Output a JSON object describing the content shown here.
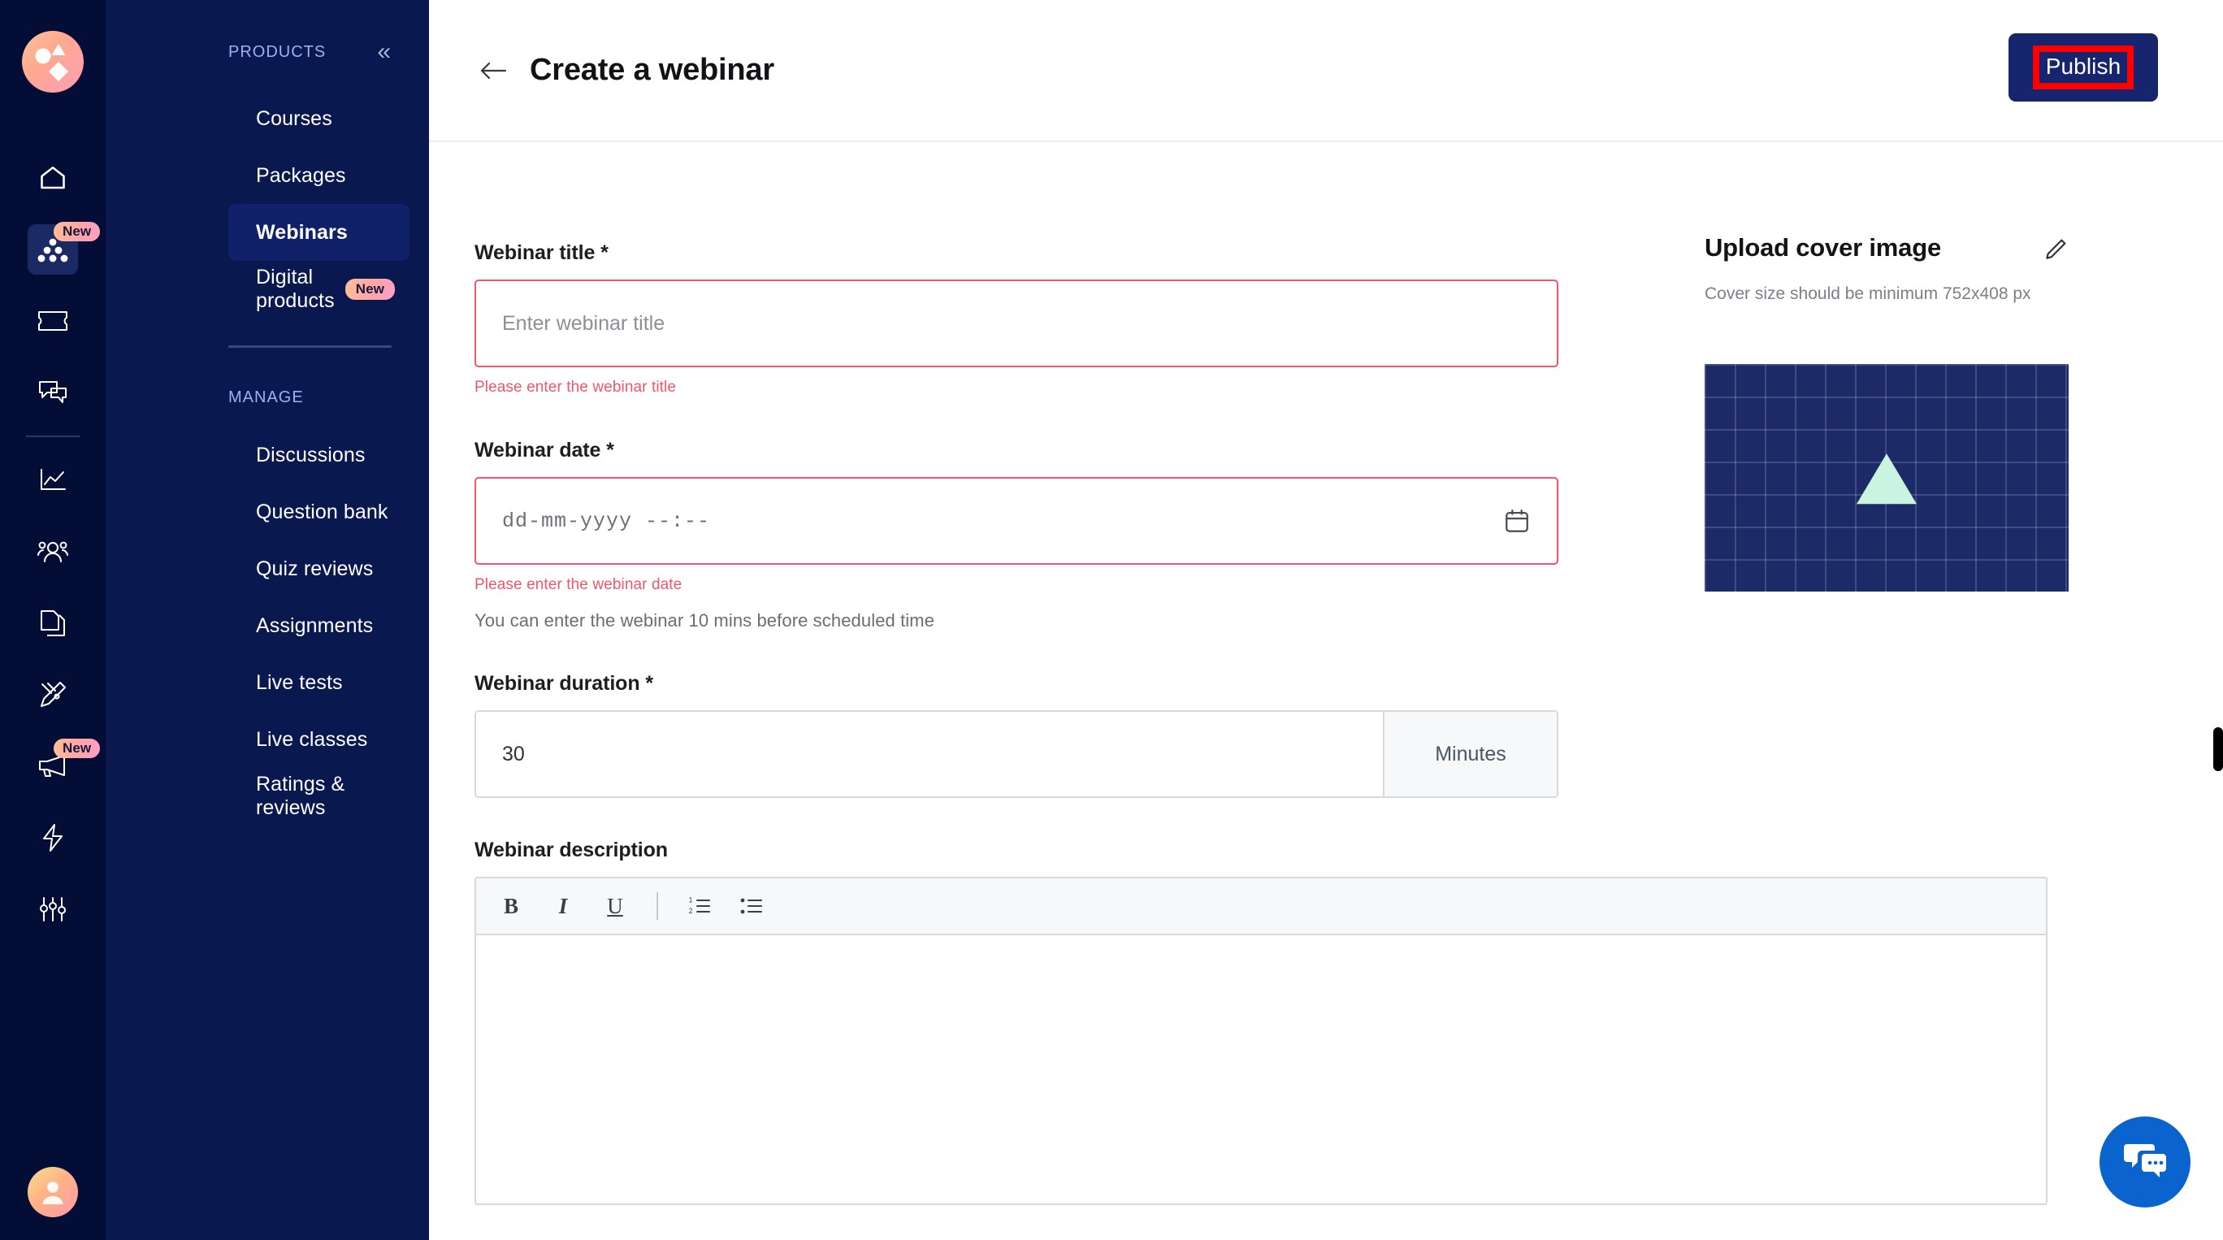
{
  "rail": {
    "logo_name": "brand-logo",
    "items": [
      {
        "icon": "home-icon",
        "badge": null,
        "active": false
      },
      {
        "icon": "products-dots-icon",
        "badge": "New",
        "active": true
      },
      {
        "icon": "ticket-icon",
        "badge": null,
        "active": false
      },
      {
        "icon": "chat-bubbles-icon",
        "badge": null,
        "active": false
      },
      {
        "icon": "analytics-chart-icon",
        "badge": null,
        "active": false
      },
      {
        "icon": "people-icon",
        "badge": null,
        "active": false
      },
      {
        "icon": "documents-copy-icon",
        "badge": null,
        "active": false
      },
      {
        "icon": "design-pen-icon",
        "badge": null,
        "active": false
      },
      {
        "icon": "megaphone-icon",
        "badge": "New",
        "active": false
      },
      {
        "icon": "lightning-bolt-icon",
        "badge": null,
        "active": false
      },
      {
        "icon": "sliders-settings-icon",
        "badge": null,
        "active": false
      }
    ],
    "avatar_name": "user-avatar"
  },
  "nav": {
    "products_heading": "PRODUCTS",
    "collapse_glyph": "«",
    "products_items": [
      {
        "label": "Courses",
        "badge": null,
        "selected": false
      },
      {
        "label": "Packages",
        "badge": null,
        "selected": false
      },
      {
        "label": "Webinars",
        "badge": null,
        "selected": true
      },
      {
        "label": "Digital products",
        "badge": "New",
        "selected": false
      }
    ],
    "manage_heading": "MANAGE",
    "manage_items": [
      {
        "label": "Discussions",
        "badge": null,
        "selected": false
      },
      {
        "label": "Question bank",
        "badge": null,
        "selected": false
      },
      {
        "label": "Quiz reviews",
        "badge": null,
        "selected": false
      },
      {
        "label": "Assignments",
        "badge": null,
        "selected": false
      },
      {
        "label": "Live tests",
        "badge": null,
        "selected": false
      },
      {
        "label": "Live classes",
        "badge": null,
        "selected": false
      },
      {
        "label": "Ratings & reviews",
        "badge": null,
        "selected": false
      }
    ]
  },
  "header": {
    "title": "Create a webinar",
    "back_icon": "arrow-left-icon",
    "publish_label": "Publish"
  },
  "form": {
    "title_field": {
      "label": "Webinar title *",
      "value": "",
      "placeholder": "Enter webinar title",
      "error": "Please enter the webinar title"
    },
    "date_field": {
      "label": "Webinar date *",
      "value": "",
      "placeholder": "dd-mm-yyyy --:--",
      "error": "Please enter the webinar date",
      "hint": "You can enter the webinar 10 mins before scheduled time",
      "icon": "calendar-icon"
    },
    "duration_field": {
      "label": "Webinar duration *",
      "value": "30",
      "unit": "Minutes"
    },
    "description_field": {
      "label": "Webinar description",
      "value": "",
      "toolbar": [
        {
          "name": "bold-icon",
          "glyph": "B"
        },
        {
          "name": "italic-icon",
          "glyph": "I"
        },
        {
          "name": "underline-icon",
          "glyph": "U"
        },
        {
          "name": "ordered-list-icon",
          "glyph": ""
        },
        {
          "name": "bullet-list-icon",
          "glyph": ""
        }
      ]
    }
  },
  "cover": {
    "title": "Upload cover image",
    "subtitle": "Cover size should be minimum 752x408 px",
    "edit_icon": "pencil-edit-icon",
    "thumbnail_name": "cover-image-preview"
  },
  "chat": {
    "icon": "chat-support-icon"
  },
  "colors": {
    "rail_bg": "#040d36",
    "nav_bg": "#0a1850",
    "nav_selected": "#10216a",
    "accent_navy": "#16256d",
    "error_red": "#f1566a",
    "annotation_red": "#ff0000",
    "badge_gradient_start": "#ffc093",
    "badge_gradient_end": "#ff9ec6",
    "chat_blue": "#0b63ce",
    "cover_bg": "#1c2a67",
    "cover_shape": "#caf4e0"
  }
}
